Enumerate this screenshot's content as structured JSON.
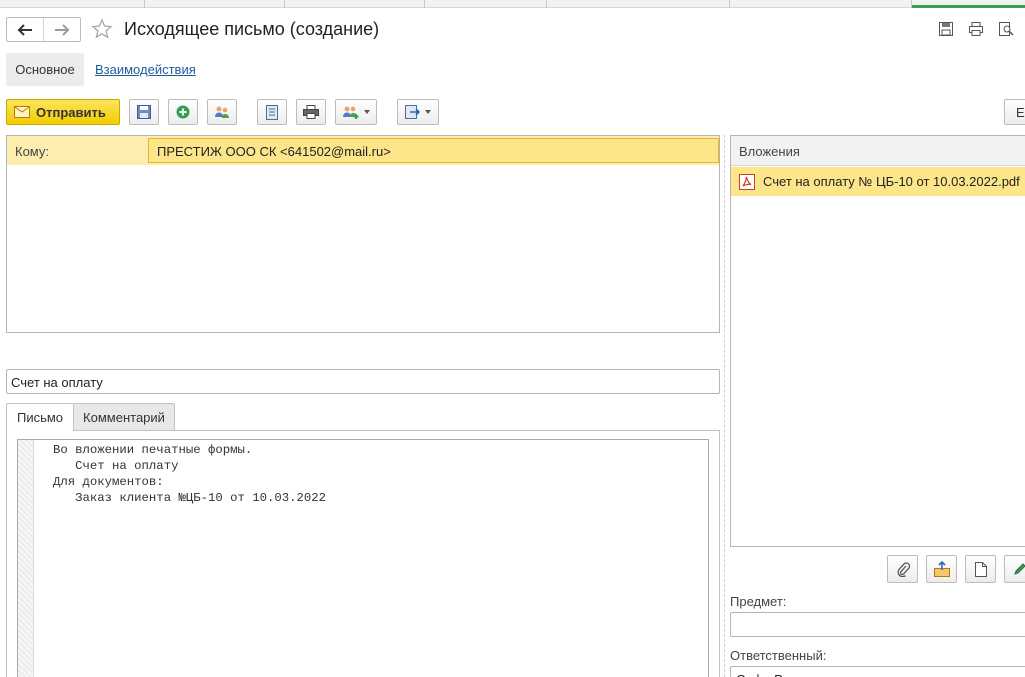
{
  "window": {
    "title": "Исходящее письмо (создание)"
  },
  "header": {
    "back_icon": "arrow-left-icon",
    "forward_icon": "arrow-right-icon",
    "favorite_icon": "star-icon",
    "right_icons": [
      "save-icon",
      "print-icon",
      "search-icon"
    ]
  },
  "form_tabs": {
    "main": "Основное",
    "interactions": "Взаимодействия"
  },
  "toolbar": {
    "send_label": "Отправить",
    "send_icon": "envelope-icon",
    "buttons": [
      "save-icon",
      "add-green-icon",
      "contacts-icon",
      "document-icon",
      "print-icon",
      "add-contact-icon",
      "export-icon"
    ],
    "right_cut_label": "Е"
  },
  "recipients": {
    "label": "Кому:",
    "value": "ПРЕСТИЖ ООО СК <641502@mail.ru>"
  },
  "subject": {
    "value": "Счет на оплату"
  },
  "body_tabs": {
    "letter": "Письмо",
    "comment": "Комментарий"
  },
  "body": {
    "lines": [
      "Во вложении печатные формы.",
      "   Счет на оплату",
      "Для документов:",
      "   Заказ клиента №ЦБ-10 от 10.03.2022"
    ]
  },
  "attachments": {
    "header": "Вложения",
    "items": [
      {
        "icon": "pdf-icon",
        "name": "Счет на оплату № ЦБ-10 от 10.03.2022.pdf"
      }
    ],
    "toolbar": [
      "paperclip-icon",
      "upload-icon",
      "document-icon",
      "edit-icon"
    ]
  },
  "fields": {
    "predmet_label": "Предмет:",
    "predmet_value": "",
    "responsible_label": "Ответственный:",
    "responsible_value": "Софа Реут"
  },
  "colors": {
    "send_button": "#f2cd00",
    "selection": "#fde68a",
    "link": "#1e5b9a",
    "active_tab_marker": "#3c9d5b"
  }
}
